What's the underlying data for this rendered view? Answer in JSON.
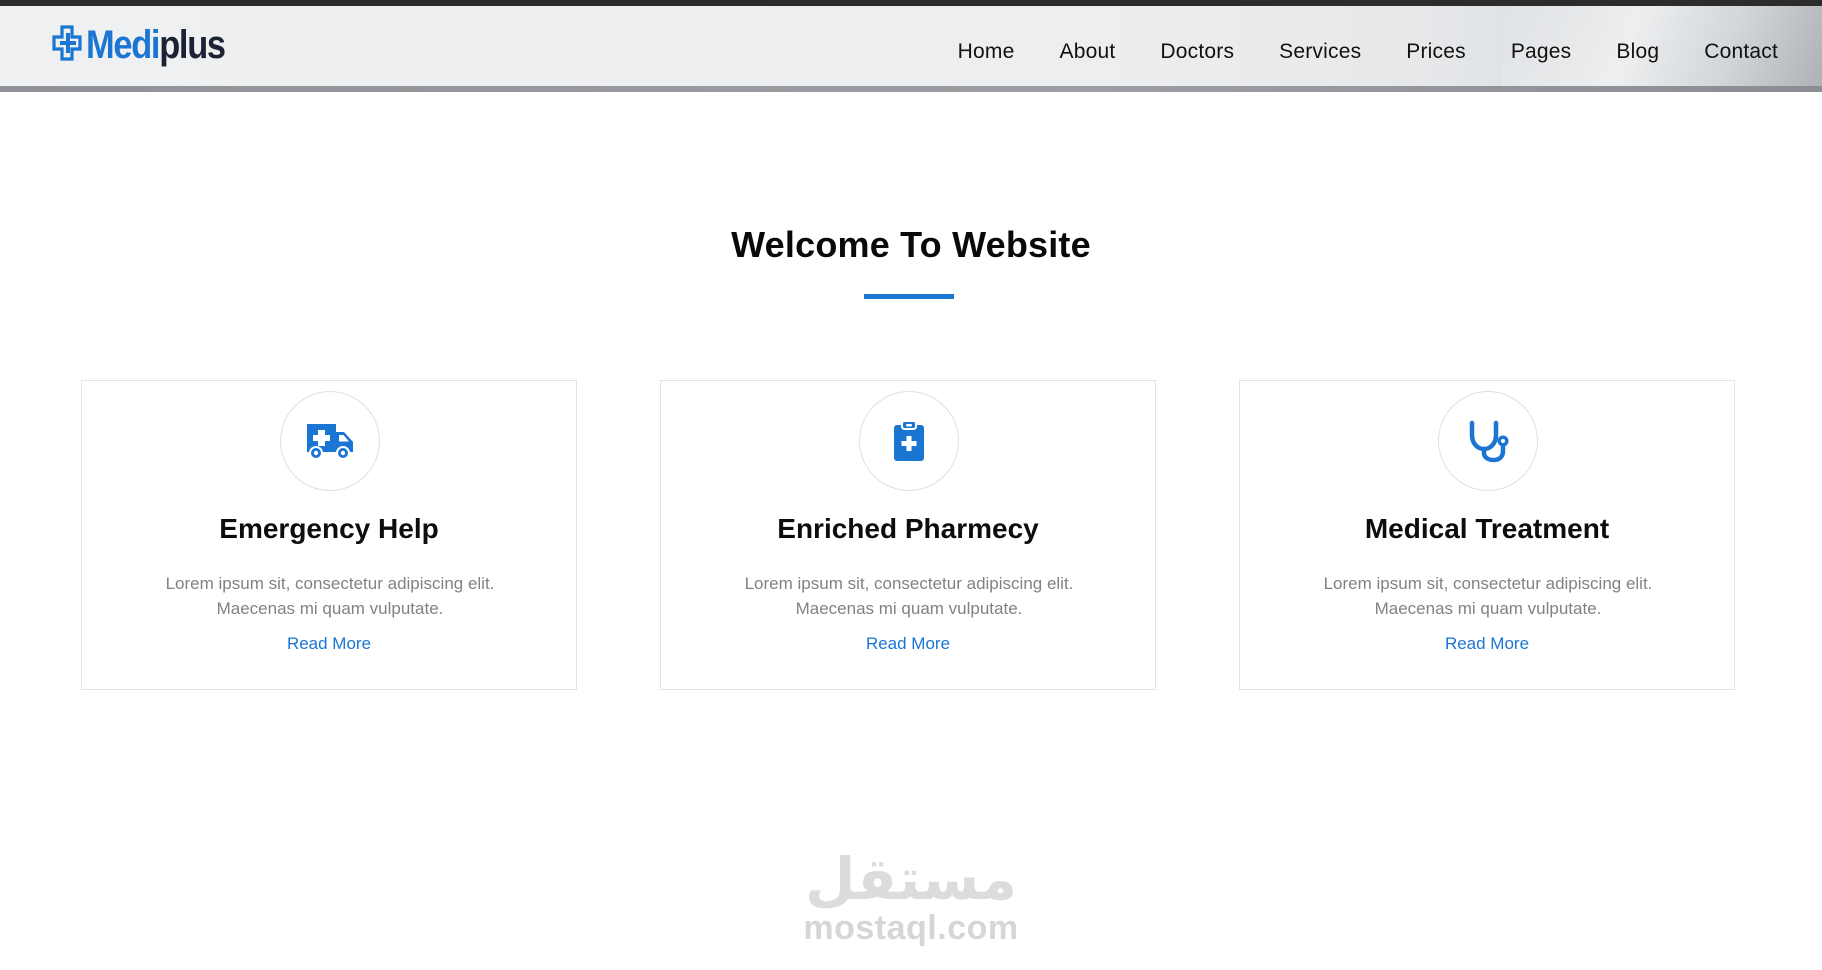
{
  "header": {
    "logo_part1": "Medi",
    "logo_part2": "plus",
    "nav": [
      "Home",
      "About",
      "Doctors",
      "Services",
      "Prices",
      "Pages",
      "Blog",
      "Contact"
    ]
  },
  "main": {
    "title": "Welcome To Website",
    "cards": [
      {
        "icon": "ambulance-icon",
        "title": "Emergency Help",
        "text": "Lorem ipsum sit, consectetur adipiscing elit. Maecenas mi quam vulputate.",
        "link": "Read More"
      },
      {
        "icon": "clipboard-medical-icon",
        "title": "Enriched Pharmecy",
        "text": "Lorem ipsum sit, consectetur adipiscing elit. Maecenas mi quam vulputate.",
        "link": "Read More"
      },
      {
        "icon": "stethoscope-icon",
        "title": "Medical Treatment",
        "text": "Lorem ipsum sit, consectetur adipiscing elit. Maecenas mi quam vulputate.",
        "link": "Read More"
      }
    ]
  },
  "watermark": {
    "arabic": "مستقل",
    "latin": "mostaql.com"
  },
  "colors": {
    "accent": "#1a76d2",
    "text_dark": "#0d0d0d",
    "text_muted": "#808285"
  }
}
